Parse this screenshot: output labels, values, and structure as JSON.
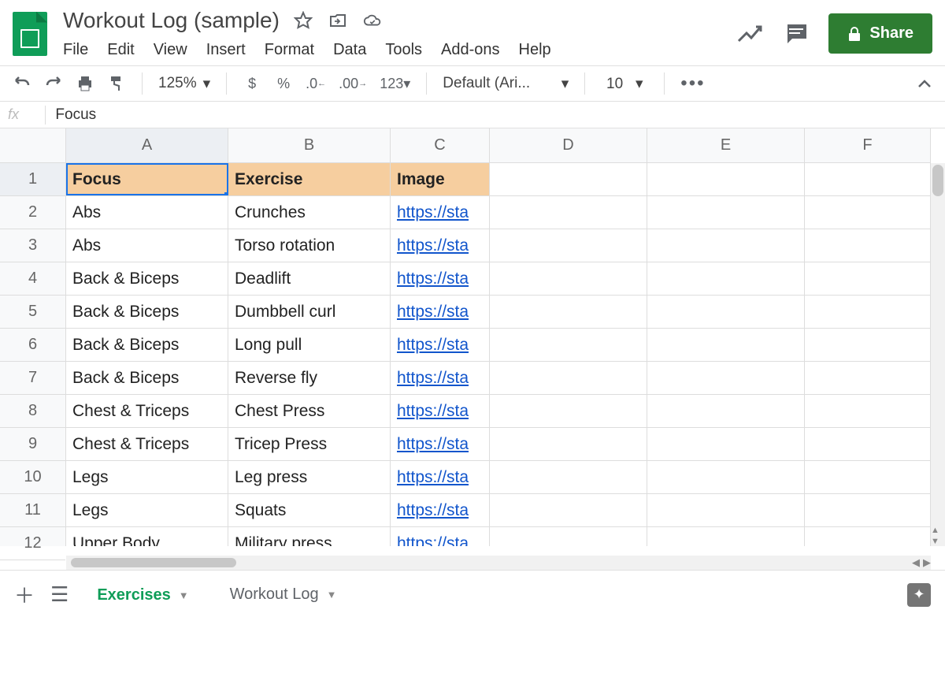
{
  "doc": {
    "title": "Workout Log (sample)"
  },
  "menu": {
    "file": "File",
    "edit": "Edit",
    "view": "View",
    "insert": "Insert",
    "format": "Format",
    "data": "Data",
    "tools": "Tools",
    "addons": "Add-ons",
    "help": "Help"
  },
  "toolbar": {
    "zoom": "125%",
    "font": "Default (Ari...",
    "size": "10",
    "currency": "$",
    "percent": "%",
    "decless": ".0",
    "decmore": ".00",
    "fmt": "123"
  },
  "share": {
    "label": "Share"
  },
  "fx": {
    "value": "Focus"
  },
  "columns": [
    "A",
    "B",
    "C",
    "D",
    "E",
    "F"
  ],
  "rownums": [
    "1",
    "2",
    "3",
    "4",
    "5",
    "6",
    "7",
    "8",
    "9",
    "10",
    "11",
    "12"
  ],
  "sheet": {
    "headers": {
      "a": "Focus",
      "b": "Exercise",
      "c": "Image"
    },
    "rows": [
      {
        "a": "Abs",
        "b": "Crunches",
        "c": "https://sta"
      },
      {
        "a": "Abs",
        "b": "Torso rotation",
        "c": "https://sta"
      },
      {
        "a": "Back & Biceps",
        "b": "Deadlift",
        "c": "https://sta"
      },
      {
        "a": "Back & Biceps",
        "b": "Dumbbell curl",
        "c": "https://sta"
      },
      {
        "a": "Back & Biceps",
        "b": "Long pull",
        "c": "https://sta"
      },
      {
        "a": "Back & Biceps",
        "b": "Reverse fly",
        "c": "https://sta"
      },
      {
        "a": "Chest & Triceps",
        "b": "Chest Press",
        "c": "https://sta"
      },
      {
        "a": "Chest & Triceps",
        "b": "Tricep Press",
        "c": "https://sta"
      },
      {
        "a": "Legs",
        "b": "Leg press",
        "c": "https://sta"
      },
      {
        "a": "Legs",
        "b": "Squats",
        "c": "https://sta"
      },
      {
        "a": "Upper Body",
        "b": "Military press",
        "c": "https://sta"
      }
    ]
  },
  "tabs": {
    "active": "Exercises",
    "other": "Workout Log"
  }
}
